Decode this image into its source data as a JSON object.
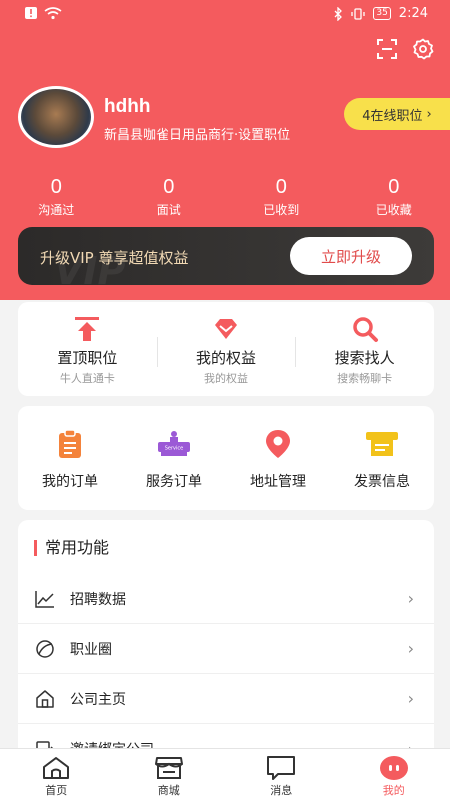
{
  "status": {
    "time": "2:24",
    "battery": "35"
  },
  "profile": {
    "name": "hdhh",
    "company": "新昌县咖雀日用品商行·设置职位",
    "online_jobs": "4在线职位"
  },
  "stats": [
    {
      "value": "0",
      "label": "沟通过"
    },
    {
      "value": "0",
      "label": "面试"
    },
    {
      "value": "0",
      "label": "已收到"
    },
    {
      "value": "0",
      "label": "已收藏"
    }
  ],
  "vip": {
    "text": "升级VIP 尊享超值权益",
    "button": "立即升级",
    "watermark": "VIP"
  },
  "quick": [
    {
      "title": "置顶职位",
      "sub": "牛人直通卡",
      "icon": "top-arrow-icon"
    },
    {
      "title": "我的权益",
      "sub": "我的权益",
      "icon": "diamond-icon"
    },
    {
      "title": "搜索找人",
      "sub": "搜索畅聊卡",
      "icon": "search-icon"
    }
  ],
  "orders": [
    {
      "label": "我的订单",
      "icon": "order-icon"
    },
    {
      "label": "服务订单",
      "icon": "service-icon"
    },
    {
      "label": "地址管理",
      "icon": "location-icon"
    },
    {
      "label": "发票信息",
      "icon": "invoice-icon"
    }
  ],
  "common": {
    "title": "常用功能",
    "items": [
      {
        "label": "招聘数据",
        "icon": "chart-icon"
      },
      {
        "label": "职业圈",
        "icon": "circle-icon"
      },
      {
        "label": "公司主页",
        "icon": "home-outline-icon"
      },
      {
        "label": "邀请绑定公司",
        "icon": "invite-icon"
      }
    ]
  },
  "tabs": [
    {
      "label": "首页",
      "icon": "home-icon"
    },
    {
      "label": "商城",
      "icon": "shop-icon"
    },
    {
      "label": "消息",
      "icon": "message-icon"
    },
    {
      "label": "我的",
      "icon": "profile-icon"
    }
  ],
  "colors": {
    "brand": "#f45b5e",
    "vip_gold": "#f1d9b4",
    "badge": "#f8e04b",
    "service_purple": "#9b59d6",
    "order_orange": "#f4833b",
    "invoice_yellow": "#f2c21a"
  }
}
